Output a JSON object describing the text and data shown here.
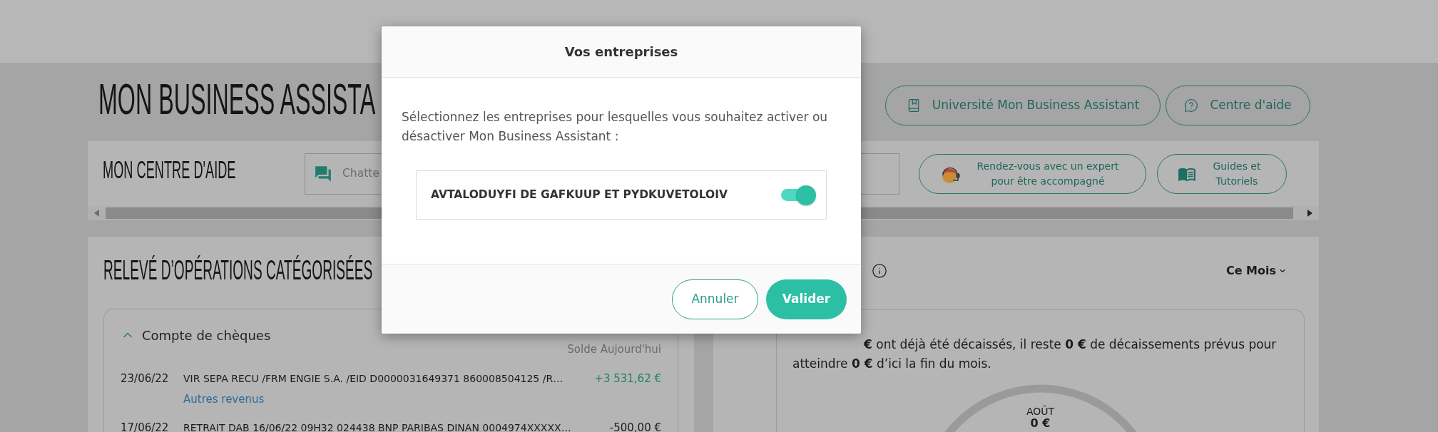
{
  "header": {
    "title": "MON BUSINESS ASSISTA",
    "buttons": [
      "Université Mon Business Assistant",
      "Centre d'aide"
    ]
  },
  "help_bar": {
    "title": "MON CENTRE D'AIDE",
    "chat_field": {
      "placeholder": "Chatte"
    },
    "buttons": [
      "Rendez-vous avec un expert pour être accompagné",
      "Guides et Tutoriels"
    ]
  },
  "statement_panel": {
    "title": "RELEVÉ D’OPÉRATIONS CATÉGORISÉES",
    "account": {
      "name": "Compte de chèques",
      "expanded": true,
      "balance_label": "Solde Aujourd'hui",
      "operations": [
        {
          "date": "23/06/22",
          "label": "VIR SEPA RECU /FRM ENGIE S.A. /EID D0000031649371 860008504125 /R…",
          "amount": "+3 531,62 €",
          "kind": "credit",
          "category": "Autres revenus"
        },
        {
          "date": "17/06/22",
          "label": "RETRAIT DAB 16/06/22 09H32 024438 BNP PARIBAS DINAN 0004974XXXXX…",
          "amount": "-500,00 €",
          "kind": "debit"
        }
      ]
    }
  },
  "forecast_panel": {
    "period": "Ce Mois",
    "summary": "**€** ont déjà été décaissés, il reste **0 €** de décaissements prévus pour atteindre **0 €** d’ici la fin du mois.",
    "gauge": {
      "month": "AOÛT",
      "amount": "0 €"
    }
  },
  "modal": {
    "title": "Vos entreprises",
    "message": "Sélectionnez les entreprises pour lesquelles vous souhaitez activer ou désactiver Mon Business Assistant :",
    "companies": [
      {
        "name": "AVTALODUYFI DE GAFKUUP ET PYDKUVETOLOIV",
        "on": true
      }
    ],
    "buttons": [
      {
        "label": "Annuler",
        "kind": "secondary"
      },
      {
        "label": "Valider",
        "kind": "primary"
      }
    ]
  }
}
